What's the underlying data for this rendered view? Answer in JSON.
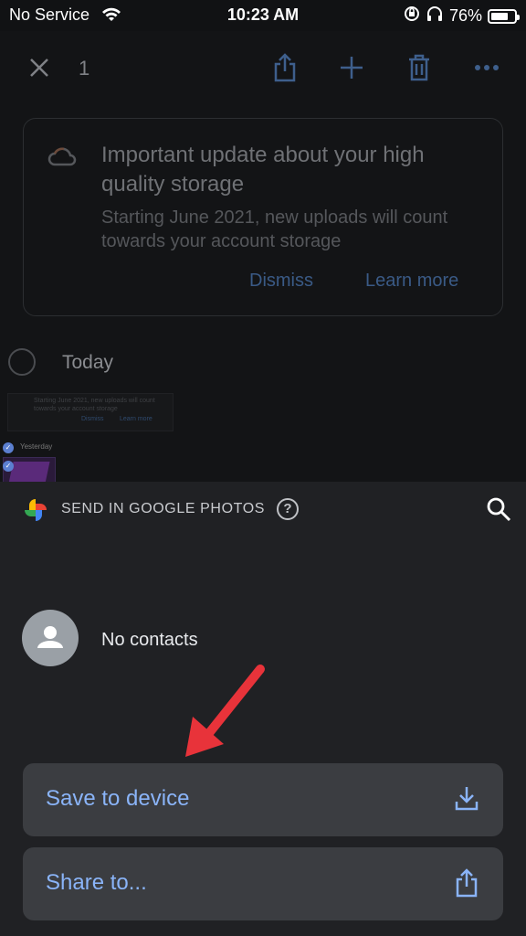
{
  "status_bar": {
    "carrier": "No Service",
    "time": "10:23 AM",
    "battery": "76%",
    "battery_level": 0.76
  },
  "toolbar": {
    "selected_count": "1",
    "icons": [
      "close-icon",
      "share-icon",
      "add-icon",
      "trash-icon",
      "more-icon"
    ]
  },
  "storage_card": {
    "title": "Important update about your high quality storage",
    "subtitle": "Starting June 2021, new uploads will count towards your account storage",
    "dismiss_label": "Dismiss",
    "learn_more_label": "Learn more"
  },
  "timeline": {
    "today_label": "Today",
    "thumb_text": "Starting June 2021, new uploads will count towards your account storage",
    "thumb_dismiss": "Dismiss",
    "thumb_learn_more": "Learn more",
    "yesterday_label": "Yesterday"
  },
  "sheet": {
    "title": "SEND IN GOOGLE PHOTOS",
    "no_contacts": "No contacts",
    "save_label": "Save to device",
    "share_label": "Share to..."
  },
  "colors": {
    "accent": "#8ab4f8",
    "sheet_bg": "#202124",
    "button_bg": "#3b3d41",
    "arrow": "#e8333a"
  }
}
